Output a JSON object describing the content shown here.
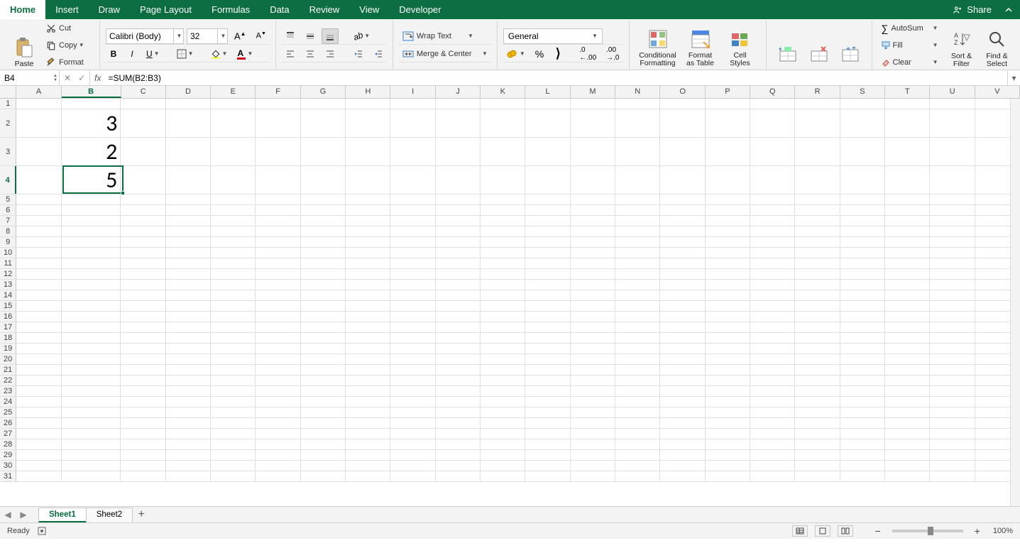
{
  "tabs": {
    "home": "Home",
    "insert": "Insert",
    "draw": "Draw",
    "page_layout": "Page Layout",
    "formulas": "Formulas",
    "data": "Data",
    "review": "Review",
    "view": "View",
    "developer": "Developer"
  },
  "share_label": "Share",
  "clipboard": {
    "paste": "Paste",
    "cut": "Cut",
    "copy": "Copy",
    "format": "Format"
  },
  "font": {
    "name": "Calibri (Body)",
    "size": "32",
    "bold": "B",
    "italic": "I",
    "underline": "U"
  },
  "align": {
    "wrap": "Wrap Text",
    "merge": "Merge & Center"
  },
  "number": {
    "format": "General"
  },
  "styles": {
    "cond": "Conditional\nFormatting",
    "fat": "Format\nas Table",
    "cell": "Cell\nStyles"
  },
  "cells": [
    {
      "ref": "B2",
      "value": "3"
    },
    {
      "ref": "B3",
      "value": "2"
    },
    {
      "ref": "B4",
      "value": "5"
    }
  ],
  "editing": {
    "autosum": "AutoSum",
    "fill": "Fill",
    "clear": "Clear",
    "sort": "Sort &\nFilter",
    "find": "Find &\nSelect"
  },
  "namebox": "B4",
  "formula": "=SUM(B2:B3)",
  "columns": [
    "A",
    "B",
    "C",
    "D",
    "E",
    "F",
    "G",
    "H",
    "I",
    "J",
    "K",
    "L",
    "M",
    "N",
    "O",
    "P",
    "Q",
    "R",
    "S",
    "T",
    "U",
    "V"
  ],
  "col_widths": {
    "default": 65,
    "B": 86
  },
  "row_heights": {
    "default": 15,
    "1": 15,
    "2": 40,
    "3": 40,
    "4": 40
  },
  "active_col": "B",
  "active_row": 4,
  "sheets": {
    "active": "Sheet1",
    "list": [
      "Sheet1",
      "Sheet2"
    ]
  },
  "status": {
    "ready": "Ready",
    "zoom": "100%"
  }
}
